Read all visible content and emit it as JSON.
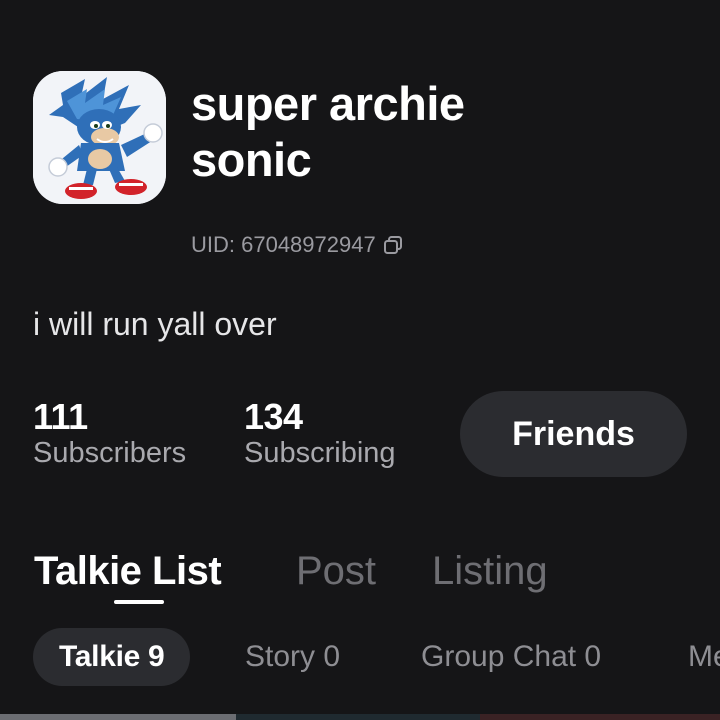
{
  "profile": {
    "name_line1": "super archie",
    "name_line2": "sonic",
    "uid": "UID: 67048972947",
    "bio": "i will run yall over",
    "avatar_icon": "character-avatar"
  },
  "stats": {
    "subscribers_count": "111",
    "subscribers_label": "Subscribers",
    "subscribing_count": "134",
    "subscribing_label": "Subscribing"
  },
  "actions": {
    "friends_label": "Friends"
  },
  "main_tabs": [
    {
      "label": "Talkie List",
      "active": true
    },
    {
      "label": "Post",
      "active": false
    },
    {
      "label": "Listing",
      "active": false
    }
  ],
  "sub_tabs": [
    {
      "label": "Talkie 9",
      "active": true
    },
    {
      "label": "Story 0",
      "active": false
    },
    {
      "label": "Group Chat 0",
      "active": false
    },
    {
      "label": "Me",
      "active": false
    }
  ],
  "colors": {
    "background": "#151517",
    "surface": "#2b2c30",
    "text_primary": "#ffffff",
    "text_secondary": "#9a9aa0",
    "text_inactive": "#6e6e73"
  }
}
